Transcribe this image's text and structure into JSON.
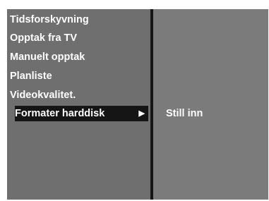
{
  "menu": {
    "items": [
      {
        "label": "Tidsforskyvning"
      },
      {
        "label": "Opptak fra TV"
      },
      {
        "label": "Manuelt opptak"
      },
      {
        "label": "Planliste"
      },
      {
        "label": "Videokvalitet."
      },
      {
        "label": "Formater harddisk",
        "selected": true,
        "arrow": "▶"
      }
    ]
  },
  "submenu": {
    "option": "Still inn"
  },
  "colors": {
    "panel_background": "#6e6e6e",
    "right_pane_background": "#7b7b7b",
    "highlight": "#151515",
    "text": "#ffffff"
  }
}
